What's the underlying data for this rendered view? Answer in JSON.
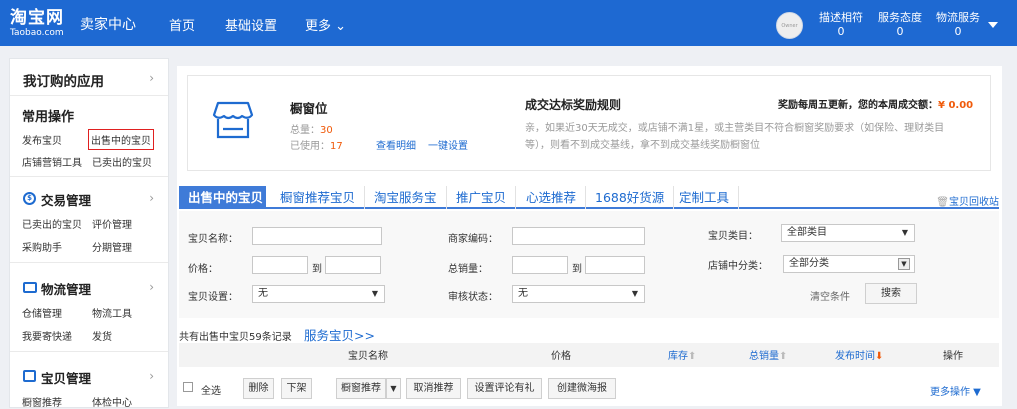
{
  "topbar": {
    "logo_cn": "淘宝网",
    "logo_en": "Taobao.com",
    "seller_center": "卖家中心",
    "nav": [
      "首页",
      "基础设置",
      "更多 ⌄"
    ],
    "avatar_text": "Owner",
    "metrics": [
      {
        "label": "描述相符",
        "value": "0"
      },
      {
        "label": "服务态度",
        "value": "0"
      },
      {
        "label": "物流服务",
        "value": "0"
      }
    ]
  },
  "sidebar": {
    "my_apps": "我订购的应用",
    "common_ops": "常用操作",
    "common_links": [
      "发布宝贝",
      "出售中的宝贝",
      "店铺营销工具",
      "已卖出的宝贝"
    ],
    "trade_title": "交易管理",
    "trade_links": [
      "已卖出的宝贝",
      "评价管理",
      "采购助手",
      "分期管理"
    ],
    "logistics_title": "物流管理",
    "logistics_links": [
      "仓储管理",
      "物流工具",
      "我要寄快递",
      "发货"
    ],
    "goods_title": "宝贝管理",
    "goods_links": [
      "橱窗推荐",
      "体检中心"
    ]
  },
  "infocard": {
    "title": "橱窗位",
    "total_label": "总量：",
    "total_value": "30",
    "used_label": "已使用：",
    "used_value": "17",
    "view_detail": "查看明细",
    "one_click": "一键设置",
    "rule_title": "成交达标奖励规则",
    "rule_desc_1": "亲，如果近30天无成交，或店铺不满1星，或主营类目不符合橱窗奖励要求（如保险、理财类目",
    "rule_desc_2": "等），则看不到成交基线，拿不到成交基线奖励橱窗位",
    "weekly_text": "奖励每周五更新，您的本周成交额：",
    "weekly_value": "¥ 0.00"
  },
  "tabs": [
    "出售中的宝贝",
    "橱窗推荐宝贝",
    "淘宝服务宝",
    "推广宝贝",
    "心选推荐",
    "1688好货源",
    "定制工具"
  ],
  "recycle": "宝贝回收站",
  "filters": {
    "name_label": "宝贝名称：",
    "code_label": "商家编码：",
    "category_label": "宝贝类目：",
    "category_value": "全部类目",
    "price_label": "价格：",
    "to": "到",
    "sales_label": "总销量：",
    "shop_category_label": "店铺中分类：",
    "shop_category_value": "全部分类",
    "setting_label": "宝贝设置：",
    "setting_value": "无",
    "audit_label": "审核状态：",
    "audit_value": "无",
    "clear": "清空条件",
    "search": "搜索"
  },
  "summary": {
    "count_text": "共有出售中宝贝59条记录",
    "service_link": "服务宝贝>>"
  },
  "table_headers": {
    "name": "宝贝名称",
    "price": "价格",
    "stock": "库存",
    "sales": "总销量",
    "time": "发布时间",
    "ops": "操作"
  },
  "actions": {
    "select_all": "全选",
    "delete": "删除",
    "offshelf": "下架",
    "showcase": "橱窗推荐",
    "cancel_recommend": "取消推荐",
    "comment_gift": "设置评论有礼",
    "create_poster": "创建微海报",
    "more_ops": "更多操作 ▼"
  },
  "colors": {
    "topbar": "#1e69d2",
    "tab_active": "#3f7bd8",
    "link": "#1e6bd0",
    "orange": "#f05a0a",
    "highlight_border": "#e02020"
  }
}
